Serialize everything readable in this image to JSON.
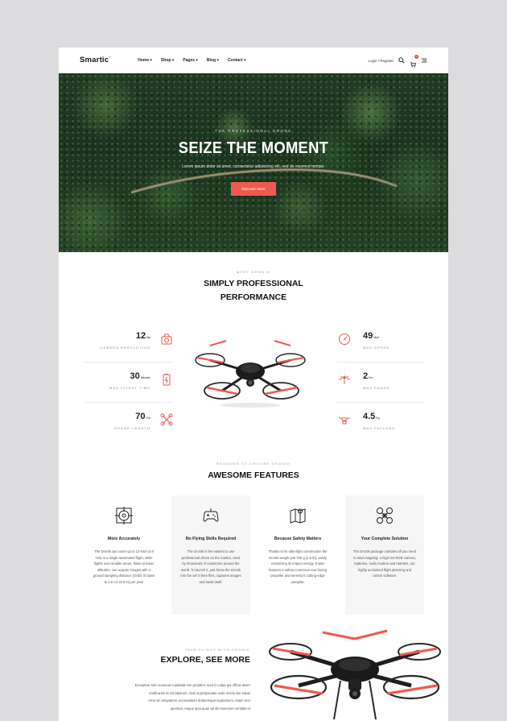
{
  "header": {
    "logo": "Smartic",
    "logo_mark": "°",
    "nav": [
      "Home ▾",
      "Shop ▾",
      "Pages ▾",
      "Blog ▾",
      "Contact ▾"
    ],
    "login": "Login / Register",
    "cart_count": "0"
  },
  "hero": {
    "kicker": "THE PROFESSIONAL DRONE",
    "title": "SEIZE THE MOMENT",
    "text": "Lorem ipsum dolor sit amet, consectetur adipisicing elit, sed do eiusmod tempor.",
    "button": "Discover More"
  },
  "performance": {
    "kicker": "MEET DRONIK",
    "title_line1": "SIMPLY PROFESSIONAL",
    "title_line2": "PERFORMANCE",
    "left_specs": [
      {
        "value": "12",
        "unit": "Mp",
        "label": "CAMERA RESOLUTION",
        "icon": "camera-icon"
      },
      {
        "value": "30",
        "unit": "Minutes",
        "label": "MAX FLIGHT TIME",
        "icon": "battery-icon"
      },
      {
        "value": "70",
        "unit": "Cm",
        "label": "DRONE LENGTH",
        "icon": "drone-frame-icon"
      }
    ],
    "right_specs": [
      {
        "value": "49",
        "unit": "Mph",
        "label": "MAX SPEED",
        "icon": "speedometer-icon"
      },
      {
        "value": "2",
        "unit": "Km",
        "label": "MAX RANGE",
        "icon": "signal-icon"
      },
      {
        "value": "4.5",
        "unit": "Kg",
        "label": "MAX PAYLOAD",
        "icon": "payload-icon"
      }
    ]
  },
  "features": {
    "kicker": "REASONS TO CHOOSE DRONIK",
    "title": "AWESOME FEATURES",
    "items": [
      {
        "title": "More Accurately",
        "icon": "target-icon",
        "text": "The Dronik can cover up to 12 km2 (4.6 mi2) in a single automated flight, while flights over smaller areas, flown at lower altitudes, can acquire images with a ground sampling distance (GSD) of down to 1.5 cm (0.6 in) per pixel"
      },
      {
        "title": "No Flying Skills Required",
        "icon": "gamepad-icon",
        "text": "The Dronik is the easiest to use professional drone on the market, used by thousands of customers around the world. To launch it, just throw the Dronik into the air! It then flies, captures images and lands itself."
      },
      {
        "title": "Because Safety Matters",
        "icon": "map-pin-icon",
        "text": "Thanks to its ultra-light construction the Dronik weight just 700 g (1.5 lb), vastly minimising its impact energy. It also features a safety-conscious rear-facing propeller and serenity's cutting-edge autopilot."
      },
      {
        "title": "Your Complete Solution",
        "icon": "quadcopter-icon",
        "text": "The Dronik package contains all you need to start mapping: a high-res RGB camera, batteries, radio modem and eMotion, our highly acclaimed flight planning and control software."
      }
    ]
  },
  "explore": {
    "kicker": "TAKE FLIGHT WITH DRONIK",
    "title": "EXPLORE, SEE MORE",
    "lines": [
      "Excepteur sint occaecat cupidatat non proident, sunt in culpa qui officia deser",
      "mollit anim id est laborum. Sed ut perspiciatis unde omnis iste natus",
      "error sit voluptatem accusantium doloremque laudantium, totam rem",
      "aperiam, eaque ipsa quae ab illo inventore veritatis et"
    ]
  },
  "colors": {
    "accent": "#ef5a4e",
    "dark": "#222222",
    "forest": "#2b4a2c"
  }
}
